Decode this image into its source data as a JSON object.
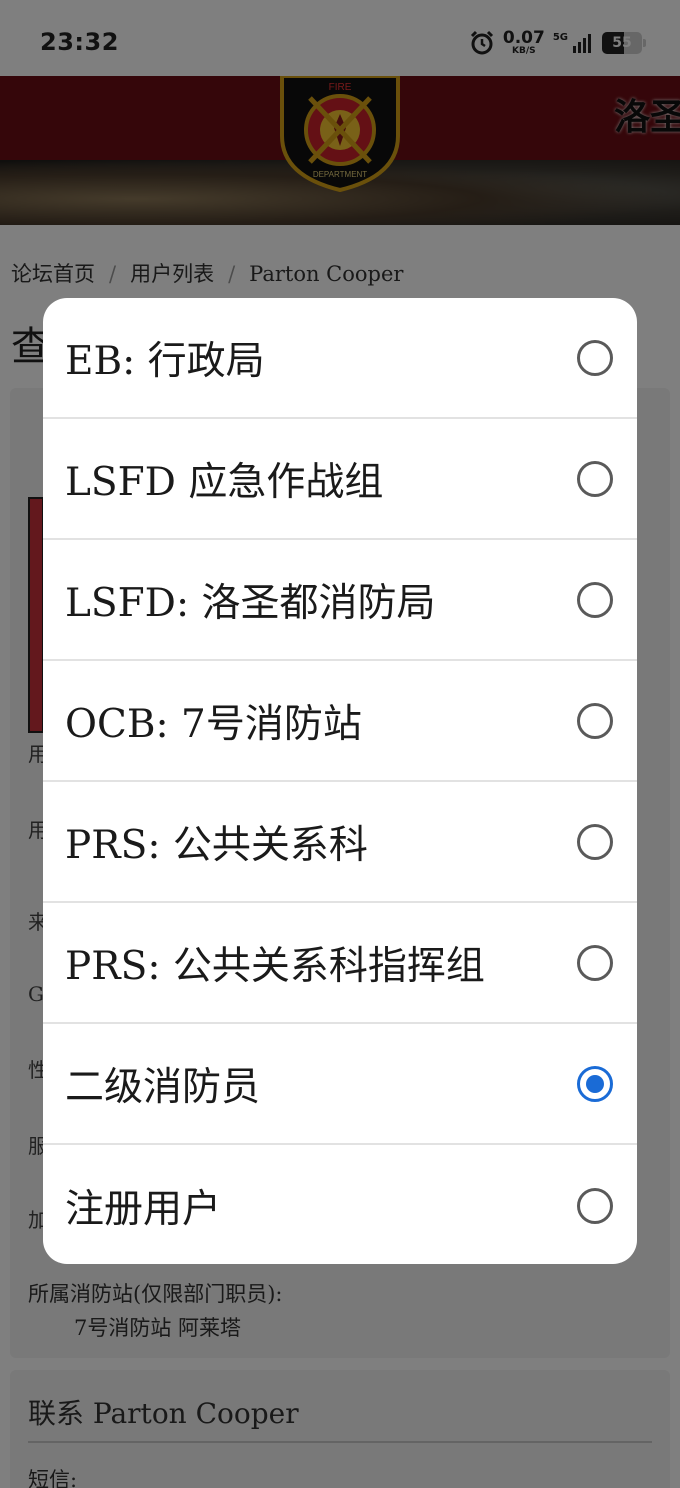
{
  "status_bar": {
    "time": "23:32",
    "net_speed": "0.07",
    "net_unit": "KB/S",
    "network": "5G",
    "battery": "55"
  },
  "banner": {
    "title_fragment": "洛圣",
    "badge_top_text": "FIRE",
    "badge_bottom_text": "DEPARTMENT"
  },
  "breadcrumb": {
    "items": [
      "论坛首页",
      "用户列表",
      "Parton Cooper"
    ],
    "separator": "/"
  },
  "page": {
    "title_fragment": "查",
    "side_chars": [
      "用",
      "用",
      "来",
      "G",
      "性",
      "服",
      "加"
    ],
    "station_label": "所属消防站(仅限部门职员):",
    "station_value": "7号消防站 阿莱塔",
    "contact_title": "联系 Parton Cooper",
    "sms_label": "短信:"
  },
  "dialog": {
    "options": [
      {
        "label": "EB: 行政局",
        "selected": false
      },
      {
        "label": "LSFD 应急作战组",
        "selected": false
      },
      {
        "label": "LSFD: 洛圣都消防局",
        "selected": false
      },
      {
        "label": "OCB: 7号消防站",
        "selected": false
      },
      {
        "label": "PRS: 公共关系科",
        "selected": false
      },
      {
        "label": "PRS: 公共关系科指挥组",
        "selected": false
      },
      {
        "label": "二级消防员",
        "selected": true
      },
      {
        "label": "注册用户",
        "selected": false
      }
    ]
  },
  "colors": {
    "accent": "#1a6bd6",
    "banner": "#6a0d14"
  }
}
